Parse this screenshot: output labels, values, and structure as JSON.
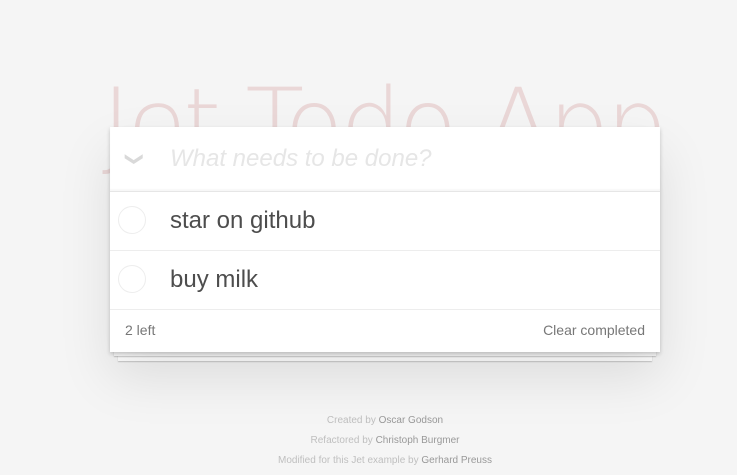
{
  "app_title": "Jet Todo-App",
  "new_todo": {
    "placeholder": "What needs to be done?",
    "value": ""
  },
  "toggle_all_icon": "chevron-down-icon",
  "todos": [
    {
      "label": "star on github",
      "completed": false
    },
    {
      "label": "buy milk",
      "completed": false
    }
  ],
  "footer": {
    "count_text": "2 left",
    "clear_completed": "Clear completed"
  },
  "info": {
    "created_prefix": "Created by",
    "created_name": "Oscar Godson",
    "refactored_prefix": "Refactored by",
    "refactored_name": "Christoph Burgmer",
    "modified_prefix": "Modified for this Jet example by",
    "modified_name": "Gerhard Preuss"
  },
  "colors": {
    "title": "#af2f2f",
    "background": "#f5f5f5"
  }
}
